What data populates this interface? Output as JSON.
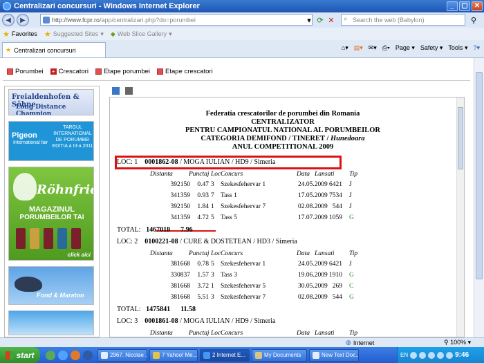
{
  "window": {
    "title": "Centralizari concursuri - Windows Internet Explorer"
  },
  "address": {
    "host": "http://www.fcpr.ro",
    "path": "/app/centralizari.php?do=porumbei"
  },
  "search": {
    "placeholder": "Search the web (Babylon)"
  },
  "favorites": {
    "label": "Favorites",
    "suggested": "Suggested Sites",
    "slice": "Web Slice Gallery"
  },
  "tab": {
    "label": "Centralizari concursuri"
  },
  "commands": {
    "page": "Page",
    "safety": "Safety",
    "tools": "Tools"
  },
  "menu": [
    {
      "label": "Porumbei"
    },
    {
      "label": "Crescatori"
    },
    {
      "label": "Etape porumbei"
    },
    {
      "label": "Etape crescatori"
    }
  ],
  "ads": {
    "ad1_line1": "Freialdenhofen & Söhne",
    "ad1_line2": "Long Distance Champion",
    "ad2_logo": "Pigeon",
    "ad2_sub": "International fair",
    "ad2_text": "TARGUL INTERNATIONAL DE PORUMBEI EDITIA a III-a 2011",
    "ad3_brand": "Röhnfried",
    "ad3_line1": "MAGAZINUL",
    "ad3_line2": "PORUMBEILOR TAI",
    "ad3_cta": "click aici",
    "ad4_text": "Fond & Maraton"
  },
  "report": {
    "h1": "Federatia crescatorilor de porumbei din Romania",
    "h2": "CENTRALIZATOR",
    "h3": "PENTRU CAMPIONATUL NATIONAL AL PORUMBEILOR",
    "h4_main": "CATEGORIA DEMIFOND / TINERET /",
    "h4_region": "Hunedoara",
    "h5": "ANUL COMPETITIONAL 2009",
    "columns": [
      "Distanta",
      "Punctaj",
      "Loc",
      "Concurs",
      "Data",
      "Lansati",
      "Tip"
    ],
    "total_label": "TOTAL:",
    "entries": [
      {
        "loc_label": "LOC: 1",
        "ring": "0001862-08",
        "rest": " / MOGA IULIAN / HD9 / Simeria",
        "rows": [
          [
            "392150",
            "0.47",
            "3",
            "Szekesfehervar 1",
            "24.05.2009",
            "6421",
            "J"
          ],
          [
            "341359",
            "0.93",
            "7",
            "Tass 1",
            "17.05.2009",
            "7534",
            "J"
          ],
          [
            "392150",
            "1.84",
            "1",
            "Szekesfehervar 7",
            "02.08.2009",
            "544",
            "J"
          ],
          [
            "341359",
            "4.72",
            "5",
            "Tass 5",
            "17.07.2009",
            "1059",
            "G"
          ]
        ],
        "total_a": "1467018",
        "total_b": "7.96"
      },
      {
        "loc_label": "LOC: 2",
        "ring": "0100221-08",
        "rest": " / CURE & DOSTETEAN / HD3 / Simeria",
        "rows": [
          [
            "381668",
            "0.78",
            "5",
            "Szekesfehervar 1",
            "24.05.2009",
            "6421",
            "J"
          ],
          [
            "330837",
            "1.57",
            "3",
            "Tass 3",
            "19.06.2009",
            "1910",
            "G"
          ],
          [
            "381668",
            "3.72",
            "1",
            "Szekesfehervar 5",
            "30.05.2009",
            "269",
            "C"
          ],
          [
            "381668",
            "5.51",
            "3",
            "Szekesfehervar 7",
            "02.08.2009",
            "544",
            "G"
          ]
        ],
        "total_a": "1475841",
        "total_b": "11.58"
      },
      {
        "loc_label": "LOC: 3",
        "ring": "0001861-08",
        "rest": " / MOGA IULIAN / HD9 / Simeria",
        "rows": []
      }
    ]
  },
  "status": {
    "zone": "Internet",
    "zoom": "100%"
  },
  "taskbar": {
    "start": "start",
    "tasks": [
      "2967. Nicolae ...",
      "7 Yahoo! Me...",
      "2 Internet E...",
      "My Documents",
      "New Text Doc..."
    ],
    "lang": "EN",
    "clock": "9:46"
  },
  "colors": {
    "highlight": "#dd1111",
    "green_tip": "#2a8a2a"
  }
}
